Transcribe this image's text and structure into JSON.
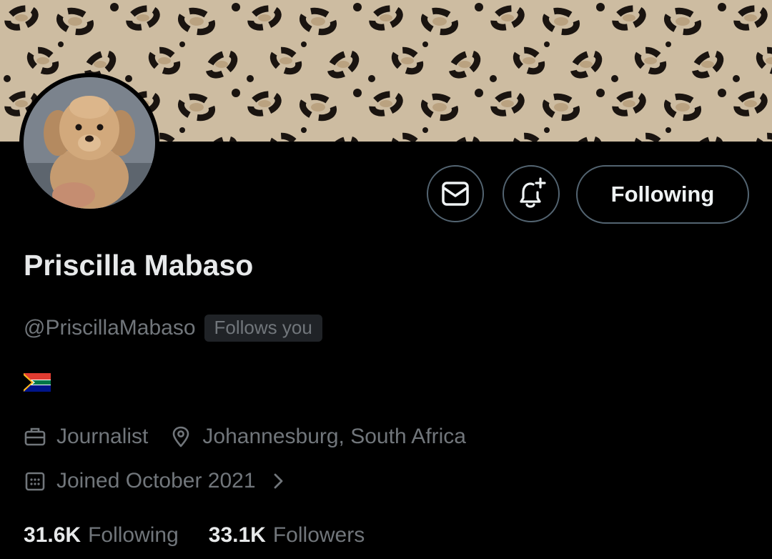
{
  "profile": {
    "display_name": "Priscilla Mabaso",
    "handle": "@PriscillaMabaso",
    "follows_you_badge": "Follows you",
    "bio_flag_icon": "south-africa-flag-icon",
    "occupation": "Journalist",
    "location": "Johannesburg, South Africa",
    "joined": "Joined October 2021"
  },
  "actions": {
    "message_icon": "envelope-icon",
    "notify_icon": "bell-plus-icon",
    "following_label": "Following"
  },
  "stats": {
    "following_count": "31.6K",
    "following_label": "Following",
    "followers_count": "33.1K",
    "followers_label": "Followers"
  },
  "colors": {
    "background": "#000000",
    "primary_text": "#e7e9ea",
    "secondary_text": "#71767b",
    "button_border": "#536471",
    "badge_bg": "#202327"
  }
}
